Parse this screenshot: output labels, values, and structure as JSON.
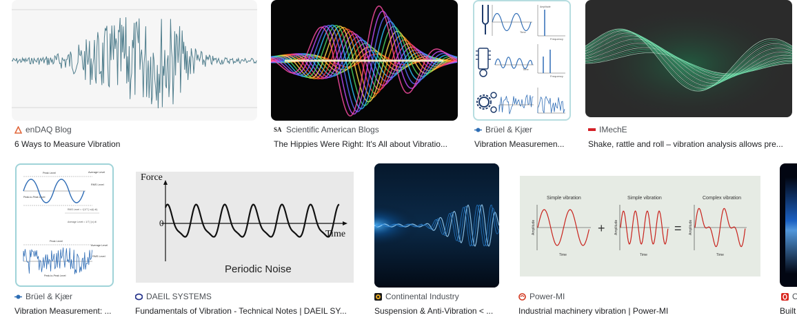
{
  "results": [
    {
      "source": "enDAQ Blog",
      "title": "6 Ways to Measure Vibration",
      "favicon": "endaq-icon"
    },
    {
      "source": "Scientific American Blogs",
      "title": "The Hippies Were Right: It's All about Vibratio...",
      "favicon": "scientific-american-icon",
      "favicon_text": "SA"
    },
    {
      "source": "Brüel & Kjær",
      "title": "Vibration Measuremen...",
      "favicon": "bruel-kjaer-icon"
    },
    {
      "source": "IMechE",
      "title": "Shake, rattle and roll – vibration analysis allows pre...",
      "favicon": "imeche-icon"
    },
    {
      "source": "Brüel & Kjær",
      "title": "Vibration Measurement: ...",
      "favicon": "bruel-kjaer-icon"
    },
    {
      "source": "DAEIL SYSTEMS",
      "title": "Fundamentals of Vibration - Technical Notes | DAEIL SY...",
      "favicon": "daeil-icon"
    },
    {
      "source": "Continental Industry",
      "title": "Suspension & Anti-Vibration < ...",
      "favicon": "continental-icon"
    },
    {
      "source": "Power-MI",
      "title": "Industrial machinery vibration | Power-MI",
      "favicon": "power-mi-icon"
    },
    {
      "source": "O",
      "title": "Built",
      "favicon": "o-icon"
    }
  ],
  "images": {
    "bk1": {
      "time": "Time",
      "frequency": "Frequency",
      "amplitude": "Amplitude"
    },
    "bk2": {
      "peak": "Peak Level",
      "avg": "Average Level",
      "rms": "RMS Level",
      "pp": "Peak-to-Peak Level"
    },
    "daeil": {
      "force": "Force",
      "zero": "0",
      "time": "Time",
      "caption": "Periodic Noise"
    },
    "powermi": {
      "simple1": "Simple vibration",
      "simple2": "Simple vibration",
      "complex": "Complex vibration",
      "plus": "+",
      "equals": "=",
      "amplitude": "Amplitude",
      "time": "Time"
    }
  }
}
